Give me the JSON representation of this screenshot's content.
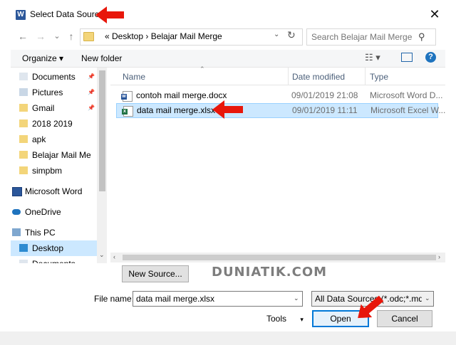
{
  "window": {
    "title": "Select Data Source",
    "close_glyph": "✕"
  },
  "nav": {
    "back_glyph": "←",
    "forward_glyph": "→",
    "down_glyph": "⌄",
    "up_glyph": "↑",
    "crumbs": "«  Desktop  ›  Belajar Mail Merge"
  },
  "search": {
    "placeholder": "Search Belajar Mail Merge"
  },
  "toolbar": {
    "organize": "Organize ▾",
    "new_folder": "New folder",
    "help": "?"
  },
  "sidebar": {
    "items": [
      {
        "label": "Documents",
        "icon": "documents-icon",
        "pinned": true
      },
      {
        "label": "Pictures",
        "icon": "pictures-icon",
        "pinned": true
      },
      {
        "label": "Gmail",
        "icon": "folder-icon",
        "pinned": true
      },
      {
        "label": "2018 2019",
        "icon": "folder-icon",
        "pinned": false
      },
      {
        "label": "apk",
        "icon": "folder-icon",
        "pinned": false
      },
      {
        "label": "Belajar Mail Me",
        "icon": "folder-icon",
        "pinned": false
      },
      {
        "label": "simpbm",
        "icon": "folder-icon",
        "pinned": false
      },
      {
        "label": "Microsoft Word",
        "icon": "word-icon",
        "pinned": false
      },
      {
        "label": "OneDrive",
        "icon": "cloud-icon",
        "pinned": false
      },
      {
        "label": "This PC",
        "icon": "computer-icon",
        "pinned": false
      },
      {
        "label": "Desktop",
        "icon": "desktop-icon",
        "pinned": false,
        "selected": true
      },
      {
        "label": "Documents",
        "icon": "documents-icon",
        "pinned": false
      }
    ]
  },
  "columns": {
    "name": "Name",
    "date": "Date modified",
    "type": "Type"
  },
  "files": [
    {
      "name": "contoh mail merge.docx",
      "date": "09/01/2019 21:08",
      "type": "Microsoft Word D...",
      "icon": "word-file-icon"
    },
    {
      "name": "data mail merge.xlsx",
      "date": "09/01/2019 11:11",
      "type": "Microsoft Excel W...",
      "icon": "excel-file-icon",
      "selected": true
    }
  ],
  "bottom": {
    "new_source": "New Source...",
    "watermark": "DUNIATIK.COM",
    "file_name_label": "File name:",
    "file_name_value": "data mail merge.xlsx",
    "file_type": "All Data Sources (*.odc;*.mdb;*",
    "tools": "Tools",
    "open": "Open",
    "cancel": "Cancel"
  },
  "colors": {
    "accent": "#0078d7",
    "selection": "#cce8ff",
    "annotation_arrow": "#e8170b"
  }
}
